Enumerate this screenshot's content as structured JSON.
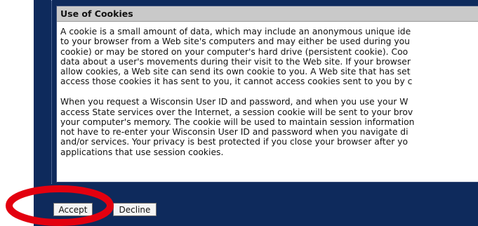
{
  "dialog": {
    "title": "Use of Cookies",
    "paragraph1": [
      "A cookie is a small amount of data, which may include an anonymous unique ide",
      "to your browser from a Web site's computers and may either be used during you",
      "cookie) or may be stored on your computer's hard drive (persistent cookie). Coo",
      "data about a user's movements during their visit to the Web site. If your browser",
      "allow cookies, a Web site can send its own cookie to you. A Web site that has set",
      "access those cookies it has sent to you, it cannot access cookies sent to you by c"
    ],
    "paragraph2": [
      "When you request a Wisconsin User ID and password, and when you use your W",
      "access State services over the Internet, a session cookie will be sent to your brov",
      "your computer's memory. The cookie will be used to maintain session information",
      "not have to re-enter your Wisconsin User ID and password when you navigate di",
      "and/or services. Your privacy is best protected if you close your browser after yo",
      "applications that use session cookies."
    ]
  },
  "buttons": {
    "accept_label": "Accept",
    "decline_label": "Decline"
  },
  "colors": {
    "frame": "#0e2a5c",
    "header_bg": "#c9c9c9",
    "annotation": "#e3000f"
  }
}
